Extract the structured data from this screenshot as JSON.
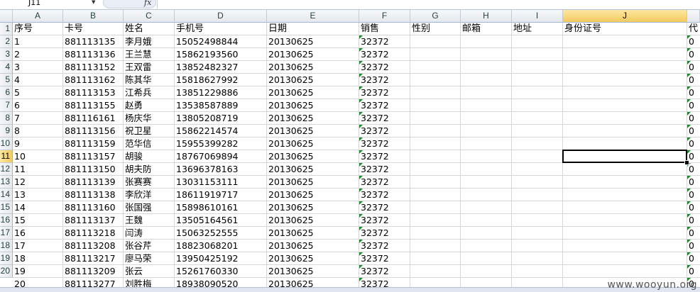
{
  "formula_bar": {
    "cell_reference": "J11",
    "formula_icon": "fx",
    "formula_value": ""
  },
  "columns": [
    "A",
    "B",
    "C",
    "D",
    "E",
    "F",
    "G",
    "H",
    "I",
    "J"
  ],
  "selected_column": "J",
  "row_numbers": [
    "1",
    "2",
    "3",
    "4",
    "5",
    "6",
    "7",
    "8",
    "9",
    "10",
    "11",
    "12",
    "13",
    "14",
    "15",
    "16",
    "17",
    "18",
    "19",
    "20"
  ],
  "selected_row": "11",
  "header_row": [
    "序号",
    "卡号",
    "姓名",
    "手机号",
    "日期",
    "销售",
    "性别",
    "邮箱",
    "地址",
    "身份证号",
    "代"
  ],
  "rows": [
    [
      "1",
      "881113135",
      "李月娥",
      "15052498844",
      "20130625",
      "32372",
      "0"
    ],
    [
      "2",
      "881113136",
      "王兰慧",
      "15862193560",
      "20130625",
      "32372",
      "0"
    ],
    [
      "3",
      "881113152",
      "王双雷",
      "13852482327",
      "20130625",
      "32372",
      "0"
    ],
    [
      "4",
      "881113162",
      "陈其华",
      "15818627992",
      "20130625",
      "32372",
      "0"
    ],
    [
      "5",
      "881113153",
      "江希兵",
      "13851229886",
      "20130625",
      "32372",
      "0"
    ],
    [
      "6",
      "881113155",
      "赵勇",
      "13538587889",
      "20130625",
      "32372",
      "0"
    ],
    [
      "7",
      "881116161",
      "杨庆华",
      "13805208719",
      "20130625",
      "32372",
      "0"
    ],
    [
      "8",
      "881113156",
      "祝卫星",
      "15862214574",
      "20130625",
      "32372",
      "0"
    ],
    [
      "9",
      "881113159",
      "范华信",
      "15955399282",
      "20130625",
      "32372",
      "0"
    ],
    [
      "10",
      "881113157",
      "胡骏",
      "18767069894",
      "20130625",
      "32372",
      "0"
    ],
    [
      "11",
      "881113150",
      "胡夫防",
      "13696378163",
      "20130625",
      "32372",
      "0"
    ],
    [
      "12",
      "881113139",
      "张赛赛",
      "13031153111",
      "20130625",
      "32372",
      "0"
    ],
    [
      "13",
      "881113138",
      "李欣洋",
      "18611919717",
      "20130625",
      "32372",
      "0"
    ],
    [
      "14",
      "881113160",
      "张国强",
      "15898610161",
      "20130625",
      "32372",
      "0"
    ],
    [
      "15",
      "881113137",
      "王魏",
      "13505164561",
      "20130625",
      "32372",
      "0"
    ],
    [
      "16",
      "881113218",
      "闫涛",
      "15063252555",
      "20130625",
      "32372",
      "0"
    ],
    [
      "17",
      "881113208",
      "张谷芹",
      "18823068201",
      "20130625",
      "32372",
      "0"
    ],
    [
      "18",
      "881113217",
      "廖马荣",
      "13950425192",
      "20130625",
      "32372",
      "0"
    ],
    [
      "19",
      "881113209",
      "张云",
      "15261760330",
      "20130625",
      "32372",
      "0"
    ],
    [
      "20",
      "881113277",
      "刘胜梅",
      "18938090520",
      "20130625",
      "32372",
      "0"
    ]
  ],
  "watermark": "www.wooyun.org",
  "colors": {
    "selection_header": "#f5c95e",
    "grid_line": "#d4d7dc",
    "text_as_number_flag": "#1e8a2a"
  }
}
